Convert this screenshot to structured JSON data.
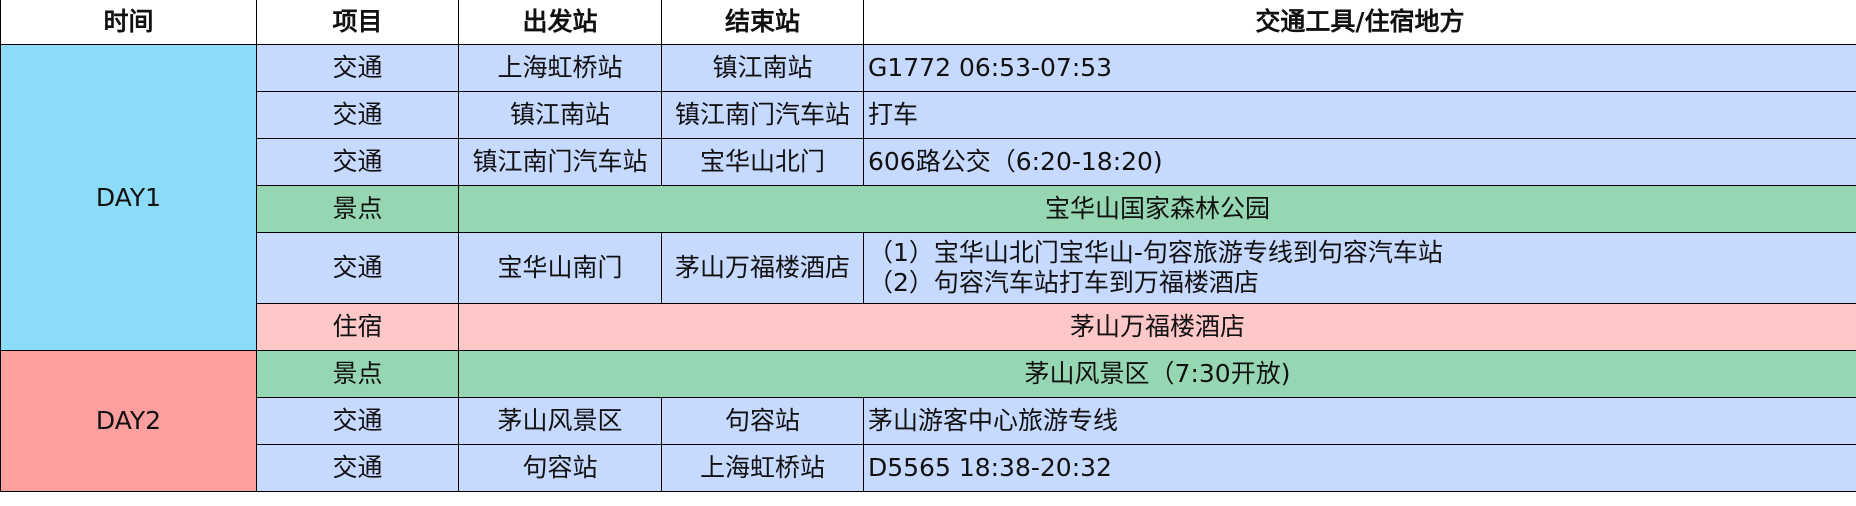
{
  "colors": {
    "day1": "#8ddcf7",
    "day2": "#fe9f9f",
    "transport": "#c6d9ff",
    "scenic": "#97d6b2",
    "lodging": "#ffc8c8",
    "border": "#000000"
  },
  "headers": {
    "time": "时间",
    "item": "项目",
    "from": "出发站",
    "to": "结束站",
    "detail": "交通工具/住宿地方"
  },
  "days": [
    {
      "label": "DAY1"
    },
    {
      "label": "DAY2"
    }
  ],
  "rows": [
    {
      "item": "交通",
      "from": "上海虹桥站",
      "to": "镇江南站",
      "detail": "G1772 06:53-07:53"
    },
    {
      "item": "交通",
      "from": "镇江南站",
      "to": "镇江南门汽车站",
      "detail": "打车"
    },
    {
      "item": "交通",
      "from": "镇江南门汽车站",
      "to": "宝华山北门",
      "detail": "606路公交（6:20-18:20)"
    },
    {
      "item": "景点",
      "detail": "宝华山国家森林公园"
    },
    {
      "item": "交通",
      "from": "宝华山南门",
      "to": "茅山万福楼酒店",
      "detail_lines": [
        "（1）宝华山北门宝华山-句容旅游专线到句容汽车站",
        "（2）句容汽车站打车到万福楼酒店"
      ]
    },
    {
      "item": "住宿",
      "detail": "茅山万福楼酒店"
    },
    {
      "item": "景点",
      "detail": "茅山风景区（7:30开放)"
    },
    {
      "item": "交通",
      "from": "茅山风景区",
      "to": "句容站",
      "detail": "茅山游客中心旅游专线"
    },
    {
      "item": "交通",
      "from": "句容站",
      "to": "上海虹桥站",
      "detail": "D5565  18:38-20:32"
    }
  ]
}
